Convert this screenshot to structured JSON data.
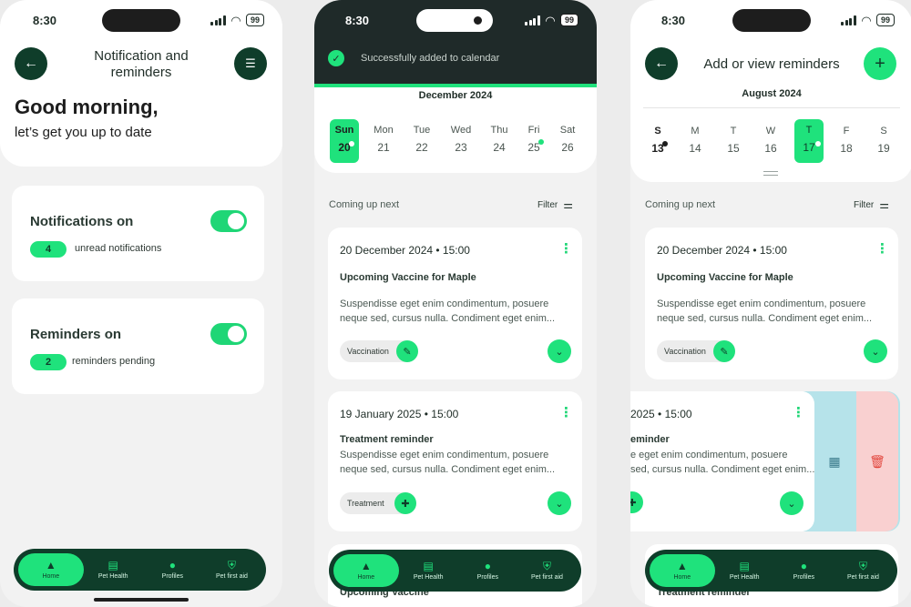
{
  "status": {
    "time": "8:30",
    "battery": "99"
  },
  "tabs": [
    {
      "label": "Home",
      "icon": "home-icon",
      "glyph": "▲"
    },
    {
      "label": "Pet Health",
      "icon": "clipboard-icon",
      "glyph": "▤"
    },
    {
      "label": "Profiles",
      "icon": "profile-icon",
      "glyph": "●"
    },
    {
      "label": "Pet first aid",
      "icon": "shield-icon",
      "glyph": "⛨"
    }
  ],
  "screen1": {
    "title_line1": "Notification and",
    "title_line2": "reminders",
    "greeting": "Good morning,",
    "subgreeting": "let’s get you up to date",
    "notifications": {
      "title": "Notifications on",
      "count": "4",
      "label": "unread notifications"
    },
    "reminders": {
      "title": "Reminders on",
      "count": "2",
      "label": "reminders pending"
    }
  },
  "screen2": {
    "toast": "Successfully added to calendar",
    "month": "December 2024",
    "days": [
      {
        "d": "Sun",
        "n": "20",
        "selected": true
      },
      {
        "d": "Mon",
        "n": "21"
      },
      {
        "d": "Tue",
        "n": "22"
      },
      {
        "d": "Wed",
        "n": "23"
      },
      {
        "d": "Thu",
        "n": "24"
      },
      {
        "d": "Fri",
        "n": "25"
      },
      {
        "d": "Sat",
        "n": "26"
      }
    ],
    "section": "Coming up next",
    "filter": "Filter",
    "card1": {
      "date": "20 December 2024 • 15:00",
      "title": "Upcoming Vaccine for Maple",
      "line1": "Suspendisse eget enim condimentum, posuere",
      "line2": "neque sed, cursus nulla. Condiment eget enim...",
      "tag": "Vaccination"
    },
    "card2": {
      "date": "19 January 2025 • 15:00",
      "title": "Treatment reminder",
      "line1": "Suspendisse eget enim condimentum, posuere",
      "line2": "neque sed, cursus nulla. Condiment eget enim...",
      "tag": "Treatment"
    },
    "card3_title": "Upcoming Vaccine"
  },
  "screen3": {
    "title": "Add or view reminders",
    "month": "August 2024",
    "days": [
      {
        "d": "S",
        "n": "13"
      },
      {
        "d": "M",
        "n": "14"
      },
      {
        "d": "T",
        "n": "15"
      },
      {
        "d": "W",
        "n": "16"
      },
      {
        "d": "T",
        "n": "17",
        "selected": true
      },
      {
        "d": "F",
        "n": "18"
      },
      {
        "d": "S",
        "n": "19"
      }
    ],
    "section": "Coming up next",
    "filter": "Filter",
    "card1": {
      "date": "20 December 2024 • 15:00",
      "title": "Upcoming Vaccine for Maple",
      "line1": "Suspendisse eget enim condimentum, posuere",
      "line2": "neque sed, cursus nulla. Condiment eget enim...",
      "tag": "Vaccination"
    },
    "card2": {
      "date": "2025 • 15:00",
      "title": "eminder",
      "line1": "e eget enim condimentum, posuere",
      "line2": "sed, cursus nulla. Condiment eget enim..."
    },
    "card3_title": "Treatment reminder"
  },
  "colors": {
    "accent": "#1fe27c",
    "dark": "#0f3d2a",
    "calendar_action": "#b6e3ea",
    "delete_action": "#f9d0d0"
  }
}
